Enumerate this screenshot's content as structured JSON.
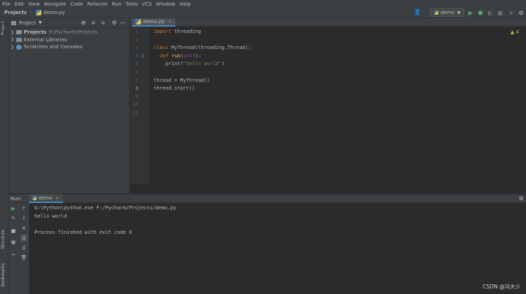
{
  "menu": [
    "File",
    "Edit",
    "View",
    "Navigate",
    "Code",
    "Refactor",
    "Run",
    "Tools",
    "VCS",
    "Window",
    "Help"
  ],
  "breadcrumb": {
    "project": "Projects",
    "file": "demo.py"
  },
  "run_config": "demo",
  "side_tabs": {
    "project": "Project",
    "structure": "Structure",
    "bookmarks": "Bookmarks"
  },
  "project_panel": {
    "title": "Project",
    "tree": [
      {
        "label": "Projects",
        "path": "F:\\Pycharm\\Projects"
      },
      {
        "label": "External Libraries"
      },
      {
        "label": "Scratches and Consoles"
      }
    ]
  },
  "editor": {
    "tab": "demo.py",
    "line_numbers": [
      "1",
      "2",
      "3",
      "4",
      "5",
      "6",
      "7",
      "8",
      "9",
      "10",
      "11"
    ],
    "lines": {
      "l1_kw": "import",
      "l1_rest": " threading",
      "l3_kw": "class",
      "l3_rest": " MyThread(threading.Thread):",
      "l4_kw": "def",
      "l4_fn": "run",
      "l4_p1": "(",
      "l4_self": "self",
      "l4_p2": "):",
      "l5_fn": "print(",
      "l5_str": "\"hello world\"",
      "l5_end": ")",
      "l6": "thread = MyThread()",
      "l7": "thread.start()"
    },
    "inspection_count": "4"
  },
  "run_panel": {
    "label": "Run:",
    "tab": "demo",
    "output": [
      "G:\\Python\\python.exe F:/Pycharm/Projects/demo.py",
      "hello world",
      "",
      "Process finished with exit code 0"
    ]
  },
  "watermark": "CSDN @冯大少"
}
